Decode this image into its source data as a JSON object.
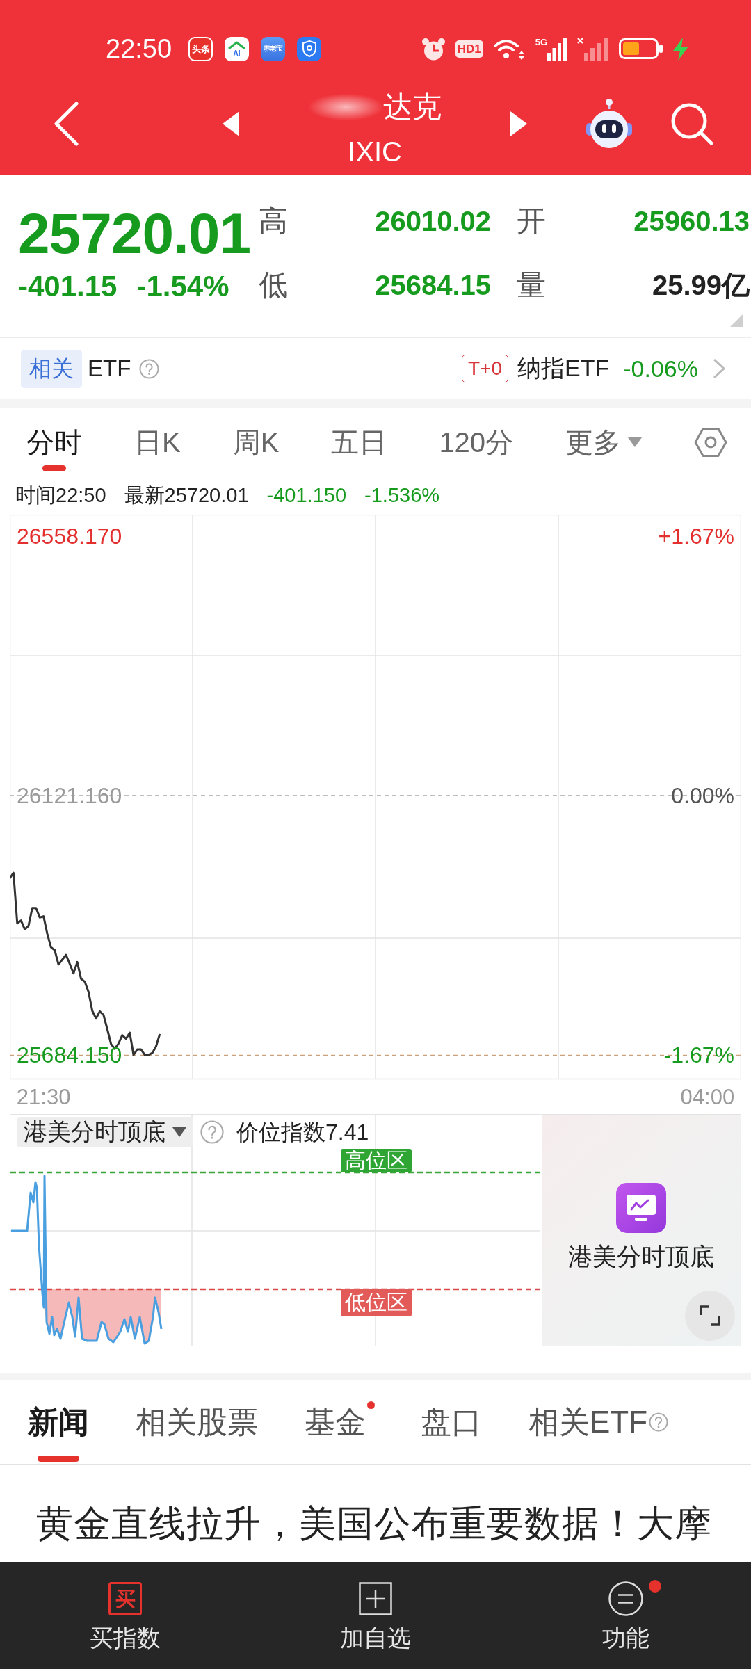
{
  "status_bar": {
    "time": "22:50",
    "app_icons": [
      {
        "kind": "red",
        "label": "头条"
      },
      {
        "kind": "house",
        "label": "AI"
      },
      {
        "kind": "blue",
        "label": "养老宝"
      },
      {
        "kind": "shield"
      }
    ],
    "hd_badge": "HD1",
    "network": "5G"
  },
  "header": {
    "title": "达克",
    "subtitle": "IXIC"
  },
  "quote": {
    "price": "25720.01",
    "change": "-401.15",
    "change_pct": "-1.54%",
    "falling": true,
    "stats": [
      {
        "label": "高",
        "value": "26010.02",
        "color": "#179b1f"
      },
      {
        "label": "开",
        "value": "25960.13",
        "color": "#179b1f"
      },
      {
        "label": "低",
        "value": "25684.15",
        "color": "#179b1f"
      },
      {
        "label": "量",
        "value": "25.99亿",
        "color": "#222222"
      }
    ]
  },
  "etf": {
    "tag": "相关",
    "label": "ETF",
    "badge": "T+0",
    "name": "纳指ETF",
    "change": "-0.06%",
    "falling": true
  },
  "chart_tabs": [
    {
      "label": "分时",
      "kind": "tab",
      "selected": true
    },
    {
      "label": "日K",
      "kind": "tab",
      "selected": false
    },
    {
      "label": "周K",
      "kind": "tab",
      "selected": false
    },
    {
      "label": "五日",
      "kind": "tab",
      "selected": false
    },
    {
      "label": "120分",
      "kind": "tab",
      "selected": false
    },
    {
      "label": "更多",
      "kind": "menu",
      "selected": false
    }
  ],
  "chart_info": {
    "time": "时间22:50",
    "latest": "最新25720.01",
    "change": "-401.150",
    "change_pct": "-1.536%",
    "falling": true
  },
  "time_chart": {
    "right_labels": [
      {
        "label": "+1.67%",
        "color": "#e3302f"
      },
      {
        "label": "0.00%",
        "color": "#555555"
      },
      {
        "label": "-1.67%",
        "color": "#179b1f"
      }
    ],
    "chart_data": {
      "type": "line",
      "categories": [
        null,
        null,
        null,
        null,
        null,
        null,
        null,
        null,
        null,
        "21:30",
        null,
        null,
        null,
        null,
        null,
        null,
        null,
        null,
        null,
        null,
        null,
        null,
        null,
        null,
        null,
        null,
        null,
        null,
        null,
        null,
        null,
        null,
        null,
        null,
        null,
        null,
        null,
        null,
        null,
        null,
        null,
        null,
        null,
        null,
        null,
        null,
        null,
        null,
        null,
        null,
        null,
        null,
        null,
        null,
        null,
        null,
        null,
        null,
        null,
        null,
        null,
        null,
        null,
        null,
        null,
        null,
        null,
        null,
        null,
        null,
        null,
        null,
        null,
        null,
        null,
        null,
        null,
        null,
        null,
        null,
        null,
        null,
        null,
        null,
        null,
        null,
        null,
        null,
        null,
        null,
        null,
        null,
        null,
        null,
        null,
        null,
        null,
        null,
        null,
        null,
        null,
        null,
        null,
        null,
        null,
        null,
        null,
        null,
        null,
        null,
        null,
        null,
        null,
        null,
        null,
        null,
        null,
        null,
        null,
        null,
        null,
        null,
        null,
        null,
        null,
        null,
        null,
        null,
        null,
        null,
        null,
        null,
        null,
        null,
        null,
        null,
        null,
        null,
        null,
        null,
        null,
        null,
        null,
        null,
        null,
        null,
        null,
        null,
        null,
        null,
        null,
        null,
        null,
        null,
        null,
        null,
        null,
        null,
        null,
        null,
        null,
        null,
        null,
        null,
        null,
        null,
        null,
        null,
        null,
        null,
        null,
        null,
        null,
        null,
        null,
        null,
        null,
        null,
        null,
        null,
        null,
        null,
        null,
        null,
        null,
        null,
        "04:00",
        null,
        null,
        null,
        null,
        null,
        null,
        null,
        null,
        null
      ],
      "values": [
        25982,
        25991,
        25906,
        25911,
        25896,
        25902,
        25932,
        25932,
        25916,
        25918,
        25889,
        25866,
        25861,
        25837,
        25845,
        25853,
        25838,
        25822,
        25841,
        25813,
        25808,
        25791,
        25759,
        25746,
        25758,
        25752,
        25728,
        25703,
        25695,
        25704,
        25718,
        25712,
        25722,
        25685,
        25694,
        25694,
        25685,
        25685,
        25688,
        25699,
        25720,
        null,
        null,
        null,
        null,
        null,
        null,
        null,
        null,
        null,
        null,
        null,
        null,
        null,
        null,
        null,
        null,
        null,
        null,
        null,
        null,
        null,
        null,
        null,
        null,
        null,
        null,
        null,
        null,
        null,
        null,
        null,
        null,
        null,
        null,
        null,
        null,
        null,
        null,
        null,
        null,
        null,
        null,
        null,
        null,
        null,
        null,
        null,
        null,
        null,
        null,
        null,
        null,
        null,
        null,
        null,
        null,
        null,
        null,
        null,
        null,
        null,
        null,
        null,
        null,
        null,
        null,
        null,
        null,
        null,
        null,
        null,
        null,
        null,
        null,
        null,
        null,
        null,
        null,
        null,
        null,
        null,
        null,
        null,
        null,
        null,
        null,
        null,
        null,
        null,
        null,
        null,
        null,
        null,
        null,
        null,
        null,
        null,
        null,
        null,
        null,
        null,
        null,
        null,
        null,
        null,
        null,
        null,
        null,
        null,
        null,
        null,
        null,
        null,
        null,
        null,
        null,
        null,
        null,
        null,
        null,
        null,
        null,
        null,
        null,
        null,
        null,
        null,
        null,
        null,
        null,
        null,
        null,
        null,
        null,
        null,
        null,
        null,
        null,
        null,
        null,
        null,
        null,
        null,
        null,
        null,
        null,
        null,
        null,
        null,
        null,
        null,
        null,
        null,
        null,
        null
      ],
      "ylim": [
        25643.78,
        26593.86
      ],
      "yticks": [
        {
          "value": 26558.17,
          "label": "26558.170"
        },
        {
          "value": 26121.16,
          "label": "26121.160"
        },
        {
          "value": 25684.15,
          "label": "25684.150"
        }
      ],
      "ref_lines": [
        {
          "axis": "y",
          "value": 26121.16
        },
        {
          "axis": "y",
          "value": 25684.15
        }
      ]
    }
  },
  "indicator": {
    "selector": "港美分时顶底",
    "index_label": "价位指数7.41",
    "high_zone": "高位区",
    "low_zone": "低位区",
    "promo_title": "港美分时顶底"
  },
  "news_tabs": [
    {
      "label": "新闻",
      "selected": true,
      "dot": false,
      "help": false
    },
    {
      "label": "相关股票",
      "selected": false,
      "dot": false,
      "help": false
    },
    {
      "label": "基金",
      "selected": false,
      "dot": true,
      "help": false
    },
    {
      "label": "盘口",
      "selected": false,
      "dot": false,
      "help": false
    },
    {
      "label": "相关ETF",
      "selected": false,
      "dot": false,
      "help": true
    }
  ],
  "news": [
    {
      "title": "黄金直线拉升，美国公布重要数据！大摩"
    }
  ],
  "bottom_nav": [
    {
      "kind": "buy",
      "icon_text": "买",
      "label": "买指数",
      "dot": false
    },
    {
      "kind": "add",
      "label": "加自选",
      "dot": false
    },
    {
      "kind": "menu",
      "label": "功能",
      "dot": true
    }
  ]
}
